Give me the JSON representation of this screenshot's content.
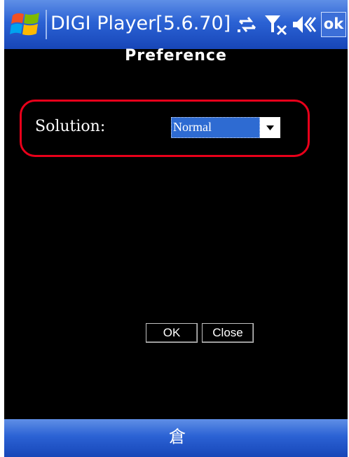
{
  "titlebar": {
    "app_title": "DIGI Player[5.6.70]",
    "ok_label": "ok",
    "icons": [
      "windows-start-icon",
      "connectivity-icon",
      "signal-icon",
      "volume-icon"
    ]
  },
  "dialog": {
    "heading": "Preference",
    "solution_label": "Solution:",
    "solution_value": "Normal",
    "ok_button": "OK",
    "close_button": "Close"
  },
  "bottombar": {
    "input_icon": "keyboard-input-icon",
    "input_glyph": "倉"
  },
  "colors": {
    "titlebar_blue": "#2b62d4",
    "background": "#000000",
    "highlight_red": "#e8001a",
    "select_highlight": "#2e6bd2"
  }
}
